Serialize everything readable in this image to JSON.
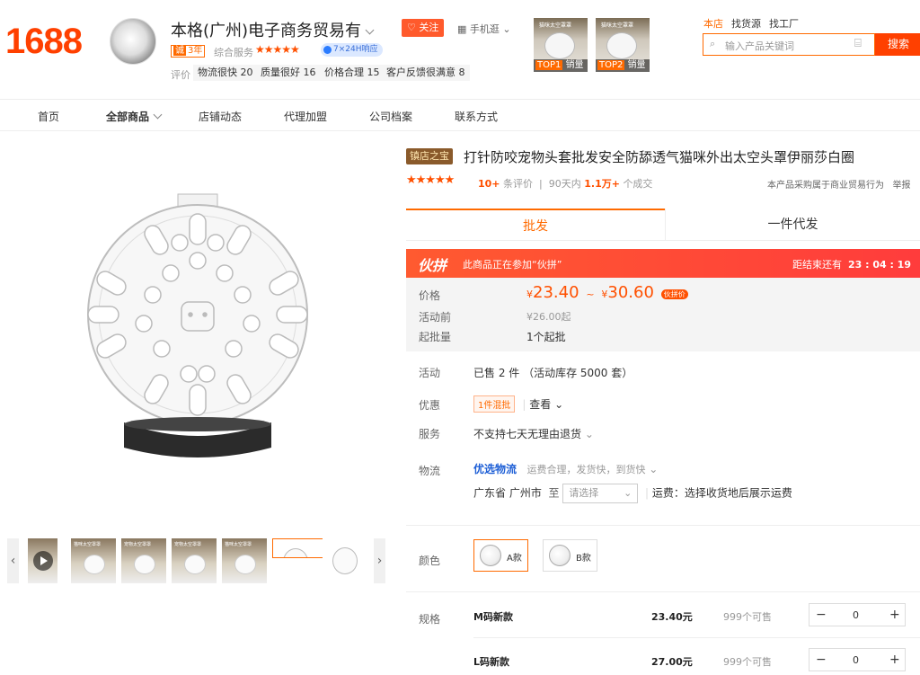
{
  "header": {
    "logo": "1688",
    "shop_name": "本格(广州)电子商务贸易有",
    "follow_label": "关注",
    "mobile_label": "手机逛",
    "years_badge": "3年",
    "service_label": "综合服务",
    "service_stars": "★★★★★",
    "online_badge": "7×24H响应",
    "eval_label": "评价",
    "eval_tags": [
      "物流很快 20",
      "质量很好 16",
      "价格合理 15",
      "客户反馈很满意 8"
    ],
    "top_products": [
      {
        "caption": "猫咪太空罩罩",
        "rank": "TOP1",
        "label": "销量"
      },
      {
        "caption": "猫咪太空罩罩",
        "rank": "TOP2",
        "label": "销量"
      }
    ],
    "search_scopes": [
      "本店",
      "找货源",
      "找工厂"
    ],
    "search_placeholder": "输入产品关键词",
    "search_button": "搜索"
  },
  "nav": [
    "首页",
    "全部商品",
    "店铺动态",
    "代理加盟",
    "公司档案",
    "联系方式"
  ],
  "gallery": {
    "thumb_captions": [
      "猫咪太空罩罩",
      "宠物太空罩罩",
      "宠物太空罩罩",
      "猫咪太空罩罩"
    ]
  },
  "product": {
    "badge": "镇店之宝",
    "title": "打针防咬宠物头套批发安全防舔透气猫咪外出太空头罩伊丽莎白圈",
    "rating_stars": "★★★★★",
    "review_count": "10+",
    "review_suffix": "条评价",
    "sales_prefix": "90天内",
    "sales_count": "1.1万+",
    "sales_suffix": "个成交",
    "purchase_note": "本产品采购属于商业贸易行为",
    "report": "举报",
    "tabs": [
      "批发",
      "一件代发"
    ],
    "group": {
      "logo": "伙拼",
      "desc": "此商品正在参加“伙拼”",
      "countdown_label": "距结束还有",
      "countdown": "23 : 04 : 19"
    },
    "price": {
      "label": "价格",
      "currency": "¥",
      "low": "23.40",
      "sep": "~",
      "high": "30.60",
      "tag": "伙拼价",
      "before_label": "活动前",
      "before_value": "¥26.00起",
      "moq_label": "起批量",
      "moq_value": "1个起批"
    },
    "activity": {
      "label": "活动",
      "value": "已售 2 件 （活动库存 5000 套）"
    },
    "discount": {
      "label": "优惠",
      "tag": "1件混批",
      "link": "查看"
    },
    "service": {
      "label": "服务",
      "value": "不支持七天无理由退货"
    },
    "logistics": {
      "label": "物流",
      "brand": "优选物流",
      "desc": "运费合理，发货快，到货快",
      "from": "广东省 广州市",
      "to_label": "至",
      "select_placeholder": "请选择",
      "fee": "运费：选择收货地后展示运费"
    },
    "colors": {
      "label": "颜色",
      "options": [
        "A款",
        "B款"
      ]
    },
    "sizes": {
      "label": "规格",
      "rows": [
        {
          "name": "M码新款",
          "price": "23.40元",
          "stock": "999个可售",
          "qty": "0"
        },
        {
          "name": "L码新款",
          "price": "27.00元",
          "stock": "999个可售",
          "qty": "0"
        }
      ]
    }
  }
}
